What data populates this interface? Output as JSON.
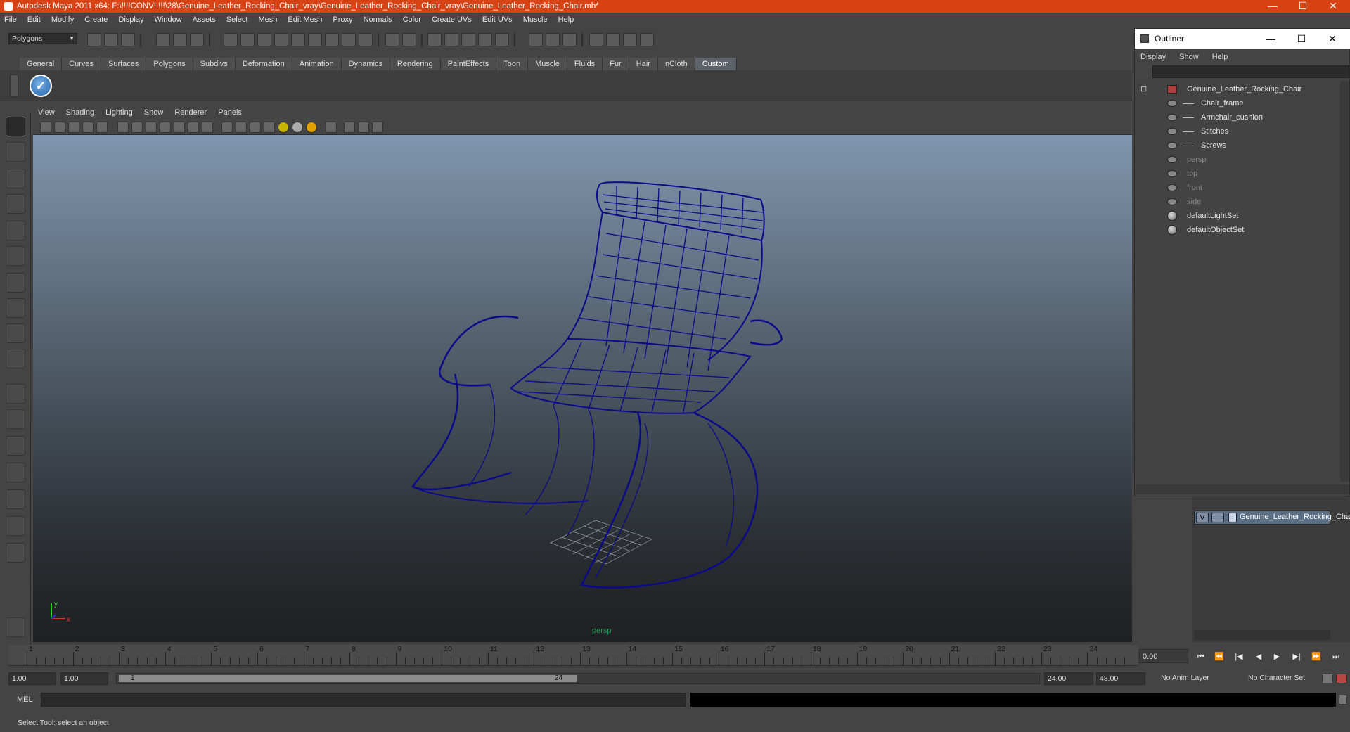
{
  "window": {
    "title": "Autodesk Maya 2011 x64: F:\\!!!!CONV!!!!!\\28\\Genuine_Leather_Rocking_Chair_vray\\Genuine_Leather_Rocking_Chair_vray\\Genuine_Leather_Rocking_Chair.mb*",
    "minimize": "—",
    "maximize": "☐",
    "close": "✕"
  },
  "menubar": [
    "File",
    "Edit",
    "Modify",
    "Create",
    "Display",
    "Window",
    "Assets",
    "Select",
    "Mesh",
    "Edit Mesh",
    "Proxy",
    "Normals",
    "Color",
    "Create UVs",
    "Edit UVs",
    "Muscle",
    "Help"
  ],
  "statusline": {
    "mode": "Polygons"
  },
  "shelf": {
    "tabs": [
      "General",
      "Curves",
      "Surfaces",
      "Polygons",
      "Subdivs",
      "Deformation",
      "Animation",
      "Dynamics",
      "Rendering",
      "PaintEffects",
      "Toon",
      "Muscle",
      "Fluids",
      "Fur",
      "Hair",
      "nCloth",
      "Custom"
    ],
    "active_tab": "Custom",
    "button_glyph": "✓"
  },
  "panel": {
    "menu": [
      "View",
      "Shading",
      "Lighting",
      "Show",
      "Renderer",
      "Panels"
    ],
    "camera_label": "persp",
    "axis_y": "y",
    "axis_x": "x"
  },
  "outliner": {
    "title": "Outliner",
    "menu": [
      "Display",
      "Show",
      "Help"
    ],
    "collapse_glyph": "⊟",
    "items": [
      {
        "label": "Genuine_Leather_Rocking_Chair",
        "dim": false
      },
      {
        "label": "Chair_frame",
        "dim": false
      },
      {
        "label": "Armchair_cushion",
        "dim": false
      },
      {
        "label": "Stitches",
        "dim": false
      },
      {
        "label": "Screws",
        "dim": false
      },
      {
        "label": "persp",
        "dim": true
      },
      {
        "label": "top",
        "dim": true
      },
      {
        "label": "front",
        "dim": true
      },
      {
        "label": "side",
        "dim": true
      },
      {
        "label": "defaultLightSet",
        "dim": false
      },
      {
        "label": "defaultObjectSet",
        "dim": false
      }
    ]
  },
  "layers": {
    "rows": [
      {
        "visible": "V",
        "name": "Genuine_Leather_Rocking_Chair"
      }
    ]
  },
  "timeline": {
    "ticks": [
      "1",
      "2",
      "3",
      "4",
      "5",
      "6",
      "7",
      "8",
      "9",
      "10",
      "11",
      "12",
      "13",
      "14",
      "15",
      "16",
      "17",
      "18",
      "19",
      "20",
      "21",
      "22",
      "23",
      "24"
    ],
    "current_frame": "0.00",
    "play_controls": [
      "⏮",
      "⏪",
      "|◀",
      "◀",
      "▶",
      "▶|",
      "⏩",
      "⏭"
    ]
  },
  "range": {
    "start": "1.00",
    "playback_start": "1.00",
    "slider_start": "1",
    "slider_end": "24",
    "playback_end": "24.00",
    "end": "48.00",
    "anim_layer": "No Anim Layer",
    "character_set": "No Character Set"
  },
  "command": {
    "label": "MEL"
  },
  "help": {
    "text": "Select Tool: select an object"
  },
  "colors": {
    "titlebar": "#d84315",
    "wireframe": "#0a0a8a",
    "viewport_top": "#7f96ae",
    "viewport_bottom": "#1e2022"
  }
}
